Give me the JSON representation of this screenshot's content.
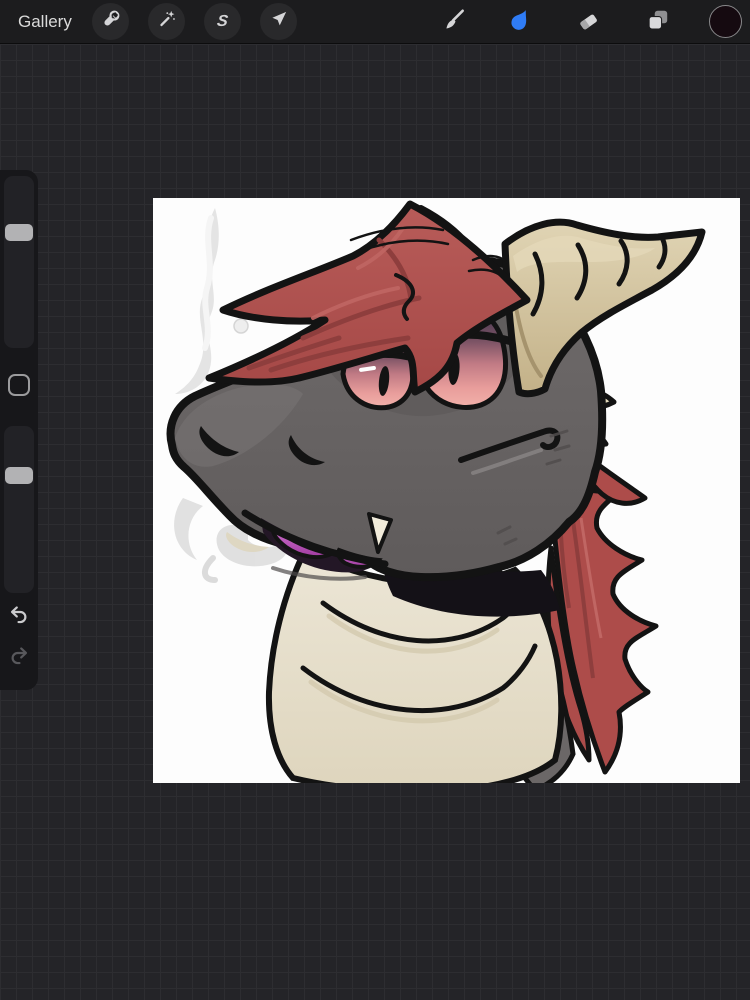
{
  "toolbar": {
    "gallery_label": "Gallery",
    "left_tools": [
      {
        "label": "Actions",
        "icon": "wrench-icon"
      },
      {
        "label": "Adjustments",
        "icon": "magic-wand-icon"
      },
      {
        "label": "Selection",
        "icon": "selection-s-icon",
        "glyph": "S"
      },
      {
        "label": "Transform",
        "icon": "transform-arrow-icon"
      }
    ],
    "right_tools": [
      {
        "label": "Paint",
        "icon": "paintbrush-icon",
        "active": false
      },
      {
        "label": "Smudge",
        "icon": "smudge-finger-icon",
        "active": true
      },
      {
        "label": "Erase",
        "icon": "eraser-icon",
        "active": false
      },
      {
        "label": "Layers",
        "icon": "layers-icon",
        "active": false
      },
      {
        "label": "Color",
        "icon": "color-swatch-circle",
        "swatch_color": "#150a10"
      }
    ],
    "active_tool_color": "#2f7cf6",
    "icon_color": "#d5d5d7"
  },
  "sidebar": {
    "brush_size_slider": {
      "handle_fraction_from_top": 0.29
    },
    "opacity_slider": {
      "handle_fraction_from_top": 0.25
    },
    "modify_button": {
      "icon": "rounded-square-icon"
    },
    "undo_button": {
      "icon": "undo-arrow-icon",
      "enabled": true
    },
    "redo_button": {
      "icon": "redo-arrow-icon",
      "enabled": false
    }
  },
  "workspace": {
    "background": "#242428",
    "grid_line": "#2d2d31",
    "toolbar_background": "#1c1c1e",
    "sidebar_background": "#17171a"
  },
  "canvas": {
    "background": "#fdfdfd",
    "artwork": {
      "subject": "cartoon dragon bust with smug half-lidded eyes, red hair, tan horns, smoke curling from nostrils",
      "palette": {
        "outline": "#131313",
        "skin_gray": "#6b6767",
        "skin_gray_dark": "#5d5959",
        "hair_red": "#ae4e4c",
        "hair_red_dark": "#8e3e3d",
        "horn_tan": "#d8caa7",
        "horn_shadow": "#c3b188",
        "chest_cream": "#eae4d3",
        "neck_spot_gray": "#8f8b8b",
        "eye_pink": "#e79c9a",
        "eye_violet": "#473850",
        "tongue_magenta": "#b14cb1",
        "fang_cream": "#f2ecdb",
        "smoke_gray": "#e0e0e0"
      }
    }
  }
}
